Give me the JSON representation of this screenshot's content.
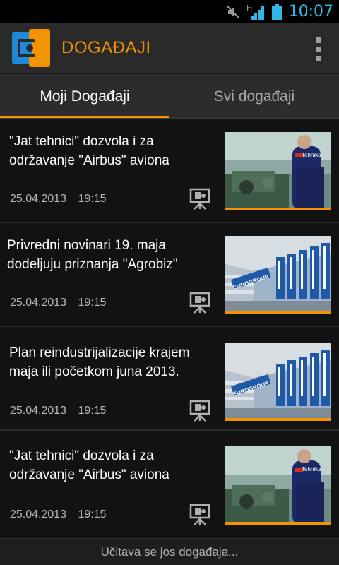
{
  "status_bar": {
    "time": "10:07",
    "icons": [
      "mute-icon",
      "signal-icon",
      "battery-icon"
    ],
    "network_label": "H"
  },
  "app": {
    "title": "DOGAĐAJI",
    "logo_icon": "app-logo-icon",
    "accent_color": "#f29400",
    "logo_color_blue": "#1e88d9"
  },
  "tabs": [
    {
      "label": "Moji Događaji",
      "active": true
    },
    {
      "label": "Svi događaji",
      "active": false
    }
  ],
  "news": [
    {
      "title_line1": "\"Jat tehnici\" dozvola i za",
      "title_line2": "održavanje \"Airbus\" aviona",
      "date": "25.04.2013",
      "time": "19:15",
      "thumb": "jat-tehnika-thumb",
      "thumb_text": "Tehnika"
    },
    {
      "title_line1": "Privredni novinari 19. maja",
      "title_line2": "dodeljuju priznanja \"Agrobiz\"",
      "date": "25.04.2013",
      "time": "19:15",
      "thumb": "eurogroup-flags-thumb",
      "thumb_text": "EUROGROUP"
    },
    {
      "title_line1": "Plan reindustrijalizacije krajem",
      "title_line2": "maja ili početkom juna 2013.",
      "date": "25.04.2013",
      "time": "19:15",
      "thumb": "eurogroup-flags-thumb",
      "thumb_text": "EUROGROUP"
    },
    {
      "title_line1": "\"Jat tehnici\" dozvola i za",
      "title_line2": "održavanje \"Airbus\" aviona",
      "date": "25.04.2013",
      "time": "19:15",
      "thumb": "jat-tehnika-thumb",
      "thumb_text": "Tehnika"
    }
  ],
  "footer": {
    "load_more": "Učitava se jos događaja..."
  }
}
